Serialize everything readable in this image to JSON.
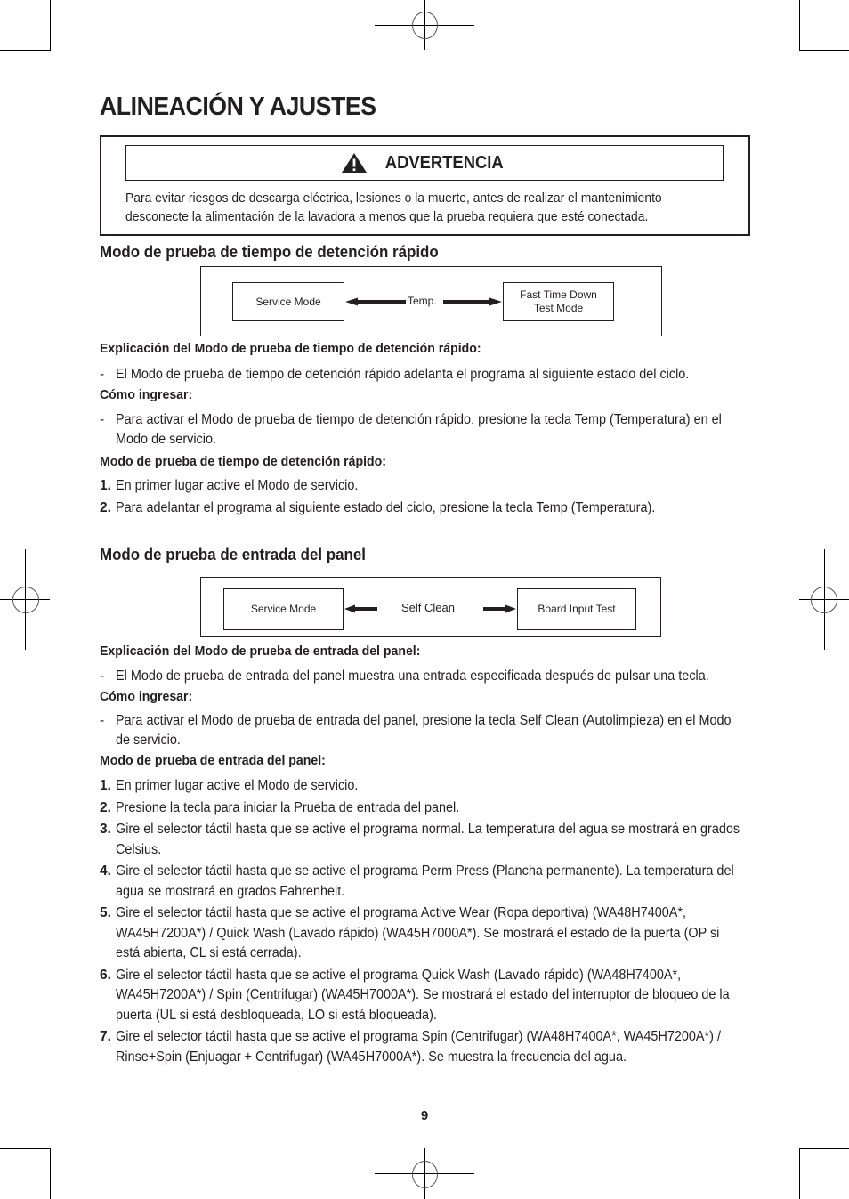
{
  "page": {
    "title": "ALINEACIÓN Y AJUSTES",
    "page_number": "9"
  },
  "warning": {
    "icon": "warning-triangle-icon",
    "heading": "ADVERTENCIA",
    "lines": [
      "Para evitar riesgos de descarga eléctrica, lesiones o la muerte, antes de realizar el mantenimiento",
      "desconecte la alimentación de la lavadora a menos que la prueba requiera que esté conectada."
    ]
  },
  "section1": {
    "heading": "Modo de prueba de tiempo de detención rápido",
    "diagram": {
      "left_box": "Service Mode",
      "key_label": "Temp.",
      "right_box_line1": "Fast Time Down",
      "right_box_line2": "Test Mode"
    },
    "explanation_heading": "Explicación del Modo de prueba de tiempo de detención rápido:",
    "explanation_items": [
      "El Modo de prueba de tiempo de detención rápido adelanta el programa al siguiente estado del ciclo."
    ],
    "how_heading": "Cómo ingresar:",
    "how_items": [
      "Para activar el Modo de prueba de tiempo de detención rápido, presione la tecla Temp (Temperatura) en el Modo de servicio."
    ],
    "steps_heading": "Modo de prueba de tiempo de detención rápido:",
    "steps": [
      {
        "n": "1.",
        "text": "En primer lugar active el Modo de servicio."
      },
      {
        "n": "2.",
        "text": "Para adelantar el programa al siguiente estado del ciclo, presione la tecla Temp  (Temperatura)."
      }
    ]
  },
  "section2": {
    "heading": "Modo de prueba de entrada del panel",
    "diagram": {
      "left_box": "Service Mode",
      "key_label": "Self Clean",
      "right_box": "Board Input Test"
    },
    "explanation_heading": "Explicación del Modo de prueba de entrada del panel:",
    "explanation_items": [
      "El Modo de prueba de entrada del panel muestra una entrada especificada después de pulsar una tecla."
    ],
    "how_heading": "Cómo ingresar:",
    "how_items": [
      "Para activar el Modo de prueba de entrada del panel, presione la tecla Self Clean (Autolimpieza) en el Modo de servicio."
    ],
    "steps_heading": "Modo de prueba de entrada del panel:",
    "steps": [
      {
        "n": "1.",
        "text": "En primer lugar active el Modo de servicio."
      },
      {
        "n": "2.",
        "text": "Presione la tecla para iniciar la Prueba de entrada del panel."
      },
      {
        "n": "3.",
        "text": "Gire el selector táctil hasta que se active el programa normal. La temperatura del agua se mostrará en grados Celsius."
      },
      {
        "n": "4.",
        "text": "Gire el selector táctil hasta que se active el programa Perm Press (Plancha permanente). La temperatura del agua se mostrará en grados Fahrenheit."
      },
      {
        "n": "5.",
        "text": "Gire el selector táctil hasta que se active el programa Active Wear (Ropa deportiva) (WA48H7400A*, WA45H7200A*) / Quick Wash (Lavado rápido) (WA45H7000A*). Se mostrará el estado de la puerta (OP si está abierta, CL si está cerrada)."
      },
      {
        "n": "6.",
        "text": "Gire el selector táctil hasta que se active el programa Quick Wash (Lavado rápido) (WA48H7400A*, WA45H7200A*) / Spin (Centrifugar) (WA45H7000A*). Se mostrará el estado del interruptor de bloqueo de la puerta (UL si está desbloqueada, LO si está bloqueada)."
      },
      {
        "n": "7.",
        "text": "Gire el selector táctil hasta que se active el programa Spin (Centrifugar) (WA48H7400A*, WA45H7200A*) / Rinse+Spin (Enjuagar + Centrifugar) (WA45H7000A*). Se muestra la frecuencia del agua."
      }
    ]
  }
}
